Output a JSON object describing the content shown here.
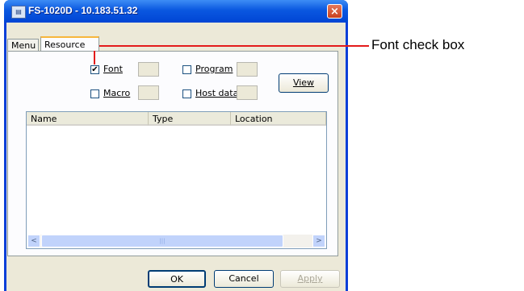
{
  "window": {
    "title": "FS-1020D - 10.183.51.32",
    "close_glyph": "×",
    "app_icon": "printer-app-icon"
  },
  "tabs": [
    {
      "label": "Menu"
    },
    {
      "label": "Resource"
    }
  ],
  "checkboxes": {
    "font": {
      "label": "Font",
      "checked": true
    },
    "program": {
      "label": "Program",
      "checked": false
    },
    "macro": {
      "label": "Macro",
      "checked": false
    },
    "host_data": {
      "label": "Host data",
      "checked": false
    }
  },
  "view_button": "View",
  "list": {
    "columns": [
      "Name",
      "Type",
      "Location"
    ],
    "rows": []
  },
  "scrollbar": {
    "left_arrow": "<",
    "right_arrow": ">"
  },
  "footer": {
    "ok": "OK",
    "cancel": "Cancel",
    "apply": "Apply"
  },
  "callout": {
    "text": "Font check box",
    "color": "#e31b1b"
  }
}
